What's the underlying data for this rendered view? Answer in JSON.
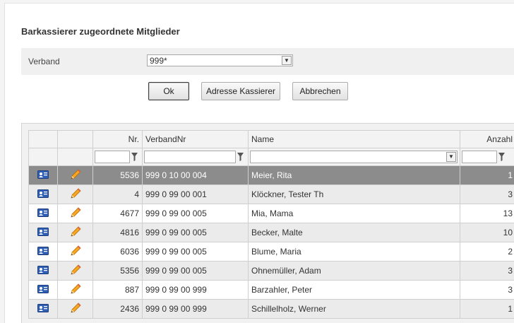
{
  "title": "Barkassierer zugeordnete Mitglieder",
  "filter": {
    "label": "Verband",
    "value": "999*",
    "arrow": "▼"
  },
  "buttons": {
    "ok": "Ok",
    "address": "Adresse Kassierer",
    "cancel": "Abbrechen"
  },
  "columns": {
    "nr": "Nr.",
    "verbandnr": "VerbandNr",
    "name": "Name",
    "anzahl": "Anzahl"
  },
  "rows": [
    {
      "nr": "5536",
      "verbandnr": "999 0 10 00 004",
      "name": "Meier, Rita",
      "anzahl": "1"
    },
    {
      "nr": "4",
      "verbandnr": "999 0 99 00 001",
      "name": "Klöckner, Tester Th",
      "anzahl": "3"
    },
    {
      "nr": "4677",
      "verbandnr": "999 0 99 00 005",
      "name": "Mia, Mama",
      "anzahl": "13"
    },
    {
      "nr": "4816",
      "verbandnr": "999 0 99 00 005",
      "name": "Becker, Malte",
      "anzahl": "10"
    },
    {
      "nr": "6036",
      "verbandnr": "999 0 99 00 005",
      "name": "Blume, Maria",
      "anzahl": "2"
    },
    {
      "nr": "5356",
      "verbandnr": "999 0 99 00 005",
      "name": "Ohnemüller, Adam",
      "anzahl": "3"
    },
    {
      "nr": "887",
      "verbandnr": "999 0 99 00 999",
      "name": "Barzahler, Peter",
      "anzahl": "3"
    },
    {
      "nr": "2436",
      "verbandnr": "999 0 99 00 999",
      "name": "Schillelholz, Werner",
      "anzahl": "1"
    }
  ],
  "icons": {
    "detail": "contact-card-icon",
    "edit": "pencil-icon",
    "filter": "funnel-icon"
  },
  "colors": {
    "selected_row": "#8c8c8c",
    "alt_row": "#ebebeb",
    "header": "#f3f3f3"
  }
}
